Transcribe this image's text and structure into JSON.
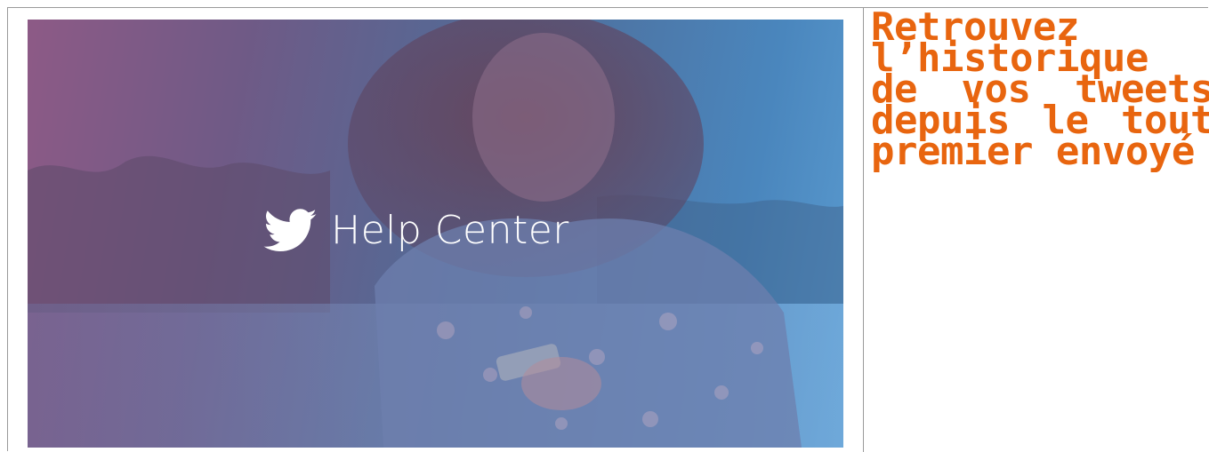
{
  "hero": {
    "brand_title": "Help Center",
    "brand_icon": "twitter-bird-icon",
    "overlay_colors": [
      "#8d5a86",
      "#4f6c98",
      "#5a9bd0"
    ]
  },
  "headline": {
    "text": "Retrouvez l’historique de vos tweets depuis le tout premier envoyé",
    "color": "#e8650f"
  }
}
